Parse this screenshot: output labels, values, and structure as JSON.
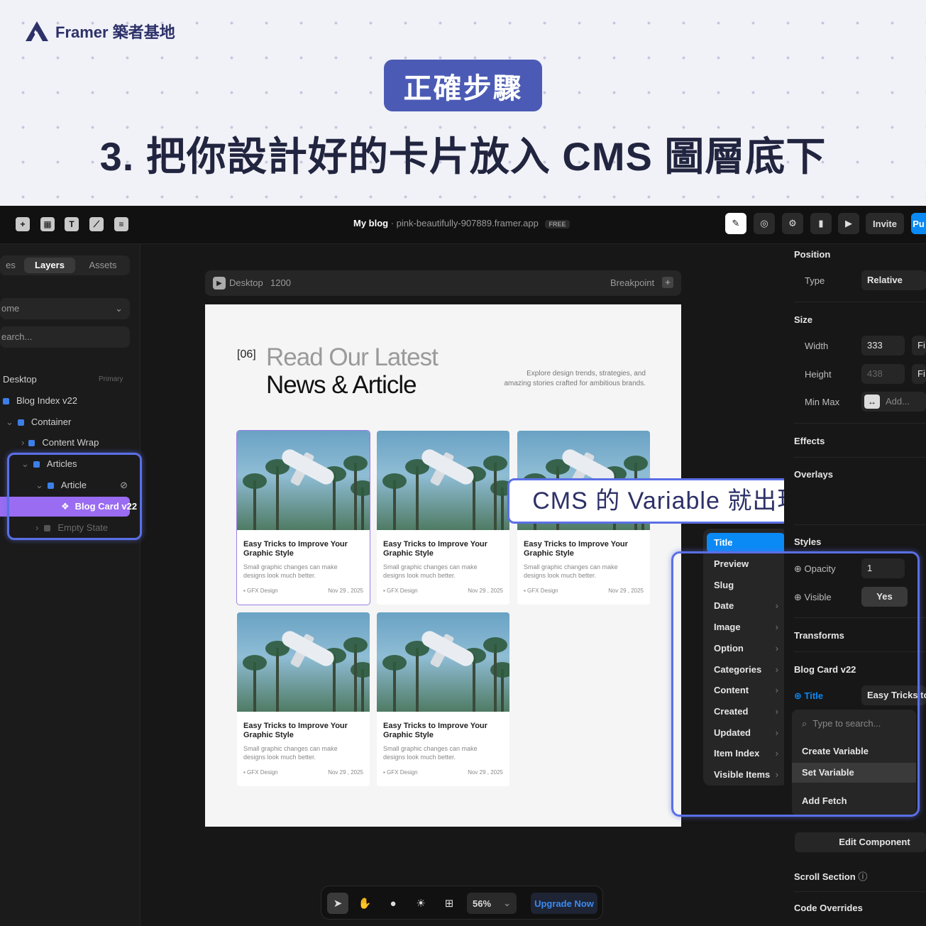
{
  "header": {
    "brand": "Framer 築者基地",
    "badge": "正確步驟",
    "headline": "3. 把你設計好的卡片放入 CMS 圖層底下"
  },
  "topbar": {
    "project": "My blog",
    "domain": "· pink-beautifully-907889.framer.app",
    "plan": "FREE",
    "invite": "Invite",
    "publish": "Pu"
  },
  "left_panel": {
    "tab_pages": "es",
    "tab_layers": "Layers",
    "tab_assets": "Assets",
    "page_select": "ome",
    "search_placeholder": "earch...",
    "layers": [
      {
        "label": "Desktop",
        "badge": "Primary"
      },
      {
        "label": "Blog Index v22"
      },
      {
        "label": "Container"
      },
      {
        "label": "Content Wrap"
      },
      {
        "label": "Articles"
      },
      {
        "label": "Article"
      },
      {
        "label": "Blog Card v22"
      },
      {
        "label": "Empty State"
      }
    ]
  },
  "canvas": {
    "breakpoint_label": "Desktop",
    "breakpoint_width": "1200",
    "breakpoint_btn": "Breakpoint",
    "section_num": "[06]",
    "title_line1": "Read Our Latest",
    "title_line2": "News & Article",
    "description": "Explore design trends, strategies, and amazing stories crafted for ambitious brands.",
    "card": {
      "title": "Easy Tricks to Improve Your Graphic Style",
      "desc": "Small graphic changes can make designs look much better.",
      "category": "▪ GFX Design",
      "date": "Nov 29 , 2025"
    }
  },
  "callout": "CMS 的 Variable 就出現了!",
  "cms_menu": {
    "items": [
      "Title",
      "Preview",
      "Slug",
      "Date",
      "Image",
      "Option",
      "Categories",
      "Content",
      "Created",
      "Updated",
      "Item Index",
      "Visible Items"
    ]
  },
  "right_panel": {
    "position": "Position",
    "type_label": "Type",
    "type_value": "Relative",
    "size": "Size",
    "width_label": "Width",
    "width_value": "333",
    "height_label": "Height",
    "height_value": "438",
    "fit": "Fi",
    "minmax_label": "Min Max",
    "minmax_value": "Add...",
    "effects": "Effects",
    "overlays": "Overlays",
    "styles": "Styles",
    "opacity_label": "Opacity",
    "opacity_value": "1",
    "visible_label": "Visible",
    "visible_value": "Yes",
    "transforms": "Transforms",
    "component": "Blog Card v22",
    "title_label": "Title",
    "title_value": "Easy Tricks to",
    "search_placeholder": "Type to search...",
    "create_variable": "Create Variable",
    "set_variable": "Set Variable",
    "add_fetch": "Add Fetch",
    "edit_component": "Edit Component",
    "scroll_section": "Scroll Section",
    "code_overrides": "Code Overrides"
  },
  "bottom_toolbar": {
    "zoom": "56%",
    "upgrade": "Upgrade Now"
  },
  "colors": {
    "accent_blue": "#5b6fe6",
    "framer_blue": "#0a8af5",
    "badge_bg": "#4b5bb5"
  }
}
